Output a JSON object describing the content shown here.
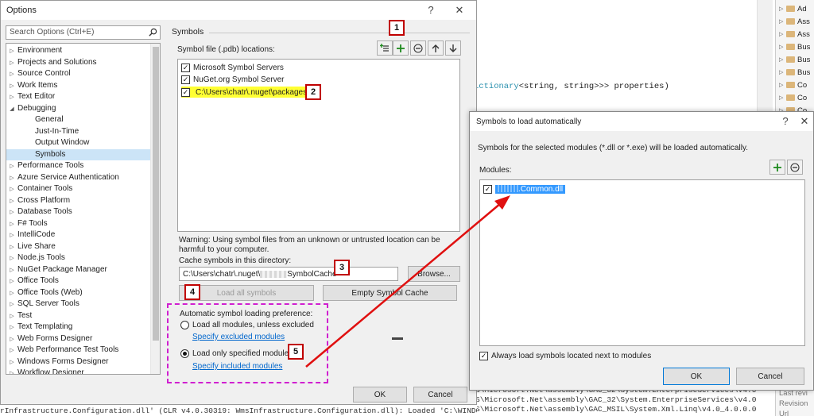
{
  "editor": {
    "code_fragment_type": "ictionary",
    "code_fragment_rest": "<string, string>>> properties)"
  },
  "output": {
    "lines": [
      "S\\Microsoft.Net\\assembly\\GAC_32\\System.EnterpriseServices\\v4.0",
      "S\\Microsoft.Net\\assembly\\GAC_32\\System.EnterpriseServices\\v4.0",
      "S\\Microsoft.Net\\assembly\\GAC_MSIL\\System.Xml.Linq\\v4.0_4.0.0.0"
    ],
    "bottom_line": "rInfrastructure.Configuration.dll' (CLR v4.0.30319: WmsInfrastructure.Configuration.dll): Loaded 'C:\\WINDOWS\\Microsoft.Net\\assembly\\GAC_MSIL\\System.Xml.Linq\\v4.0_4.0.0.0"
  },
  "solution": {
    "items": [
      "Ad",
      "Ass",
      "Ass",
      "Bus",
      "Bus",
      "Bus",
      "Co",
      "Co",
      "Co",
      "Co"
    ],
    "bottom_labels": [
      "Last revi",
      "Revision",
      "Url"
    ]
  },
  "options": {
    "title": "Options",
    "help_glyph": "?",
    "close_glyph": "✕",
    "search_placeholder": "Search Options (Ctrl+E)",
    "tree": [
      {
        "label": "Environment",
        "arrow": "▷",
        "indent": 0
      },
      {
        "label": "Projects and Solutions",
        "arrow": "▷",
        "indent": 0
      },
      {
        "label": "Source Control",
        "arrow": "▷",
        "indent": 0
      },
      {
        "label": "Work Items",
        "arrow": "▷",
        "indent": 0
      },
      {
        "label": "Text Editor",
        "arrow": "▷",
        "indent": 0
      },
      {
        "label": "Debugging",
        "arrow": "◢",
        "indent": 0
      },
      {
        "label": "General",
        "arrow": "",
        "indent": 1
      },
      {
        "label": "Just-In-Time",
        "arrow": "",
        "indent": 1
      },
      {
        "label": "Output Window",
        "arrow": "",
        "indent": 1
      },
      {
        "label": "Symbols",
        "arrow": "",
        "indent": 1,
        "selected": true
      },
      {
        "label": "Performance Tools",
        "arrow": "▷",
        "indent": 0
      },
      {
        "label": "Azure Service Authentication",
        "arrow": "▷",
        "indent": 0
      },
      {
        "label": "Container Tools",
        "arrow": "▷",
        "indent": 0
      },
      {
        "label": "Cross Platform",
        "arrow": "▷",
        "indent": 0
      },
      {
        "label": "Database Tools",
        "arrow": "▷",
        "indent": 0
      },
      {
        "label": "F# Tools",
        "arrow": "▷",
        "indent": 0
      },
      {
        "label": "IntelliCode",
        "arrow": "▷",
        "indent": 0
      },
      {
        "label": "Live Share",
        "arrow": "▷",
        "indent": 0
      },
      {
        "label": "Node.js Tools",
        "arrow": "▷",
        "indent": 0
      },
      {
        "label": "NuGet Package Manager",
        "arrow": "▷",
        "indent": 0
      },
      {
        "label": "Office Tools",
        "arrow": "▷",
        "indent": 0
      },
      {
        "label": "Office Tools (Web)",
        "arrow": "▷",
        "indent": 0
      },
      {
        "label": "SQL Server Tools",
        "arrow": "▷",
        "indent": 0
      },
      {
        "label": "Test",
        "arrow": "▷",
        "indent": 0
      },
      {
        "label": "Text Templating",
        "arrow": "▷",
        "indent": 0
      },
      {
        "label": "Web Forms Designer",
        "arrow": "▷",
        "indent": 0
      },
      {
        "label": "Web Performance Test Tools",
        "arrow": "▷",
        "indent": 0
      },
      {
        "label": "Windows Forms Designer",
        "arrow": "▷",
        "indent": 0
      },
      {
        "label": "Workflow Designer",
        "arrow": "▷",
        "indent": 0
      }
    ],
    "section_title": "Symbols",
    "locations_label": "Symbol file (.pdb) locations:",
    "locations": [
      {
        "label": "Microsoft Symbol Servers",
        "checked": true
      },
      {
        "label": "NuGet.org Symbol Server",
        "checked": true
      },
      {
        "label": "C:\\Users\\chatr\\.nuget\\packages",
        "checked": true,
        "highlight": true
      }
    ],
    "warning": "Warning: Using symbol files from an unknown or untrusted location can be harmful to your computer.",
    "cache_label": "Cache symbols in this directory:",
    "cache_path_prefix": "C:\\Users\\chatr\\.nuget\\",
    "cache_path_suffix": "SymbolCache",
    "browse_label": "Browse...",
    "load_all_label": "Load all symbols",
    "empty_cache_label": "Empty Symbol Cache",
    "auto_pref_label": "Automatic symbol loading preference:",
    "radio_all_label": "Load all modules, unless excluded",
    "link_excluded": "Specify excluded modules",
    "radio_specified_label": "Load only specified modules",
    "link_included": "Specify included modules",
    "ok_label": "OK",
    "cancel_label": "Cancel",
    "checkmark": "✓"
  },
  "symbols_dialog": {
    "title": "Symbols to load automatically",
    "help_glyph": "?",
    "close_glyph": "✕",
    "description": "Symbols for the selected modules (*.dll or *.exe) will be loaded automatically.",
    "modules_label": "Modules:",
    "module_item": ".Common.dll",
    "always_load_label": "Always load symbols located next to modules",
    "ok_label": "OK",
    "cancel_label": "Cancel"
  },
  "markers": [
    "1",
    "2",
    "3",
    "4",
    "5"
  ],
  "colors": {
    "marker_border": "#c00000",
    "highlight": "#ffff33",
    "dashed_box": "#d020d0",
    "arrow": "#e01010",
    "selection": "#cce4f7"
  }
}
